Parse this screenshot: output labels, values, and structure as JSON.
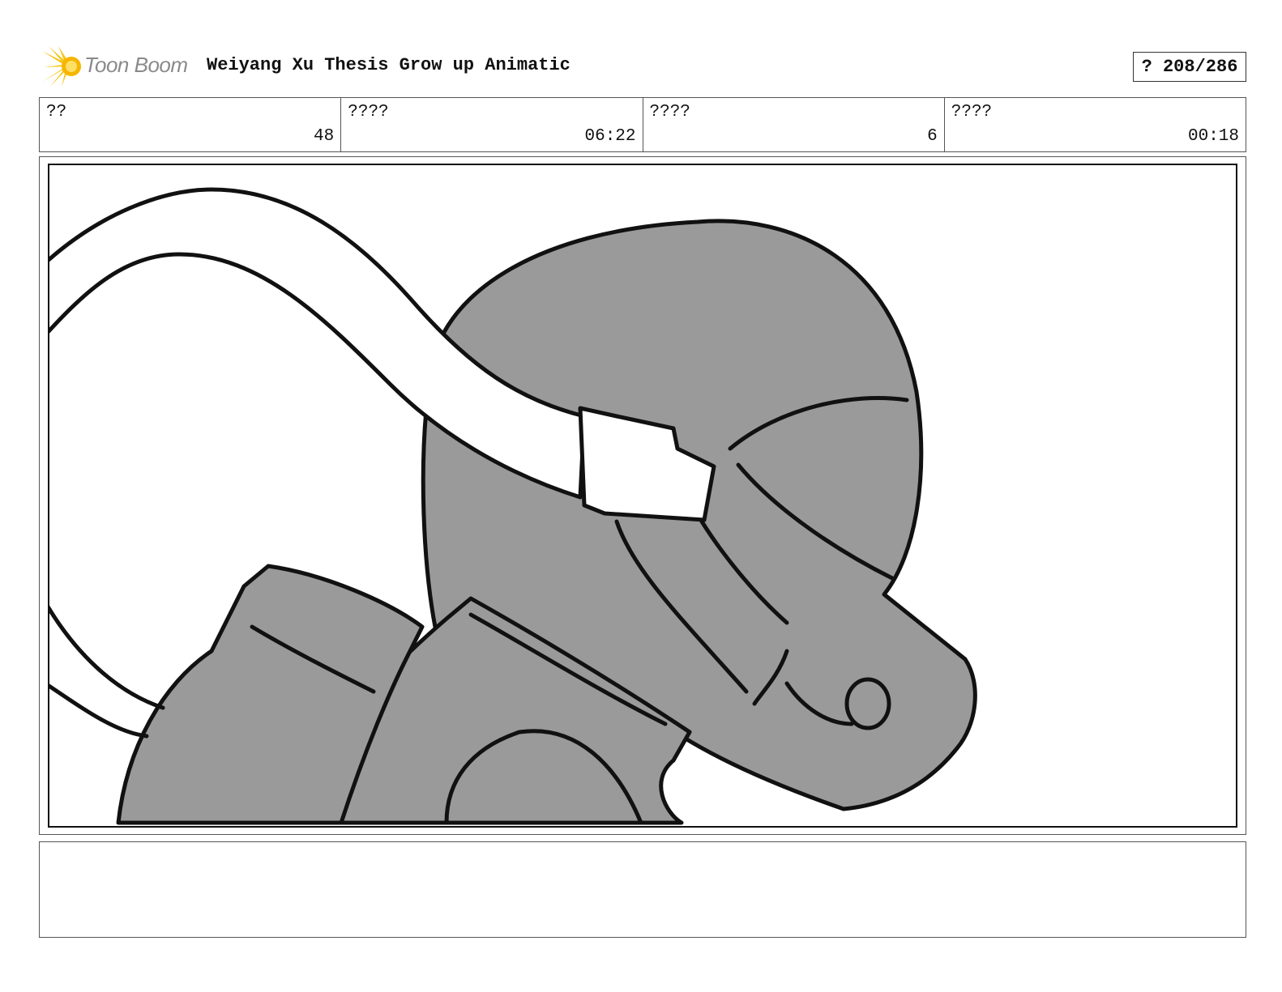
{
  "header": {
    "logo_text": "Toon Boom",
    "project_title": "Weiyang Xu Thesis Grow up Animatic",
    "page_counter": "? 208/286"
  },
  "info_row": [
    {
      "label": "??",
      "value": "48"
    },
    {
      "label": "????",
      "value": "06:22"
    },
    {
      "label": "????",
      "value": "6"
    },
    {
      "label": "????",
      "value": "00:18"
    }
  ],
  "notes": {
    "text": ""
  },
  "colors": {
    "logo_accent": "#f5c518",
    "sketch_fill": "#9a9a9a",
    "line": "#111111"
  }
}
